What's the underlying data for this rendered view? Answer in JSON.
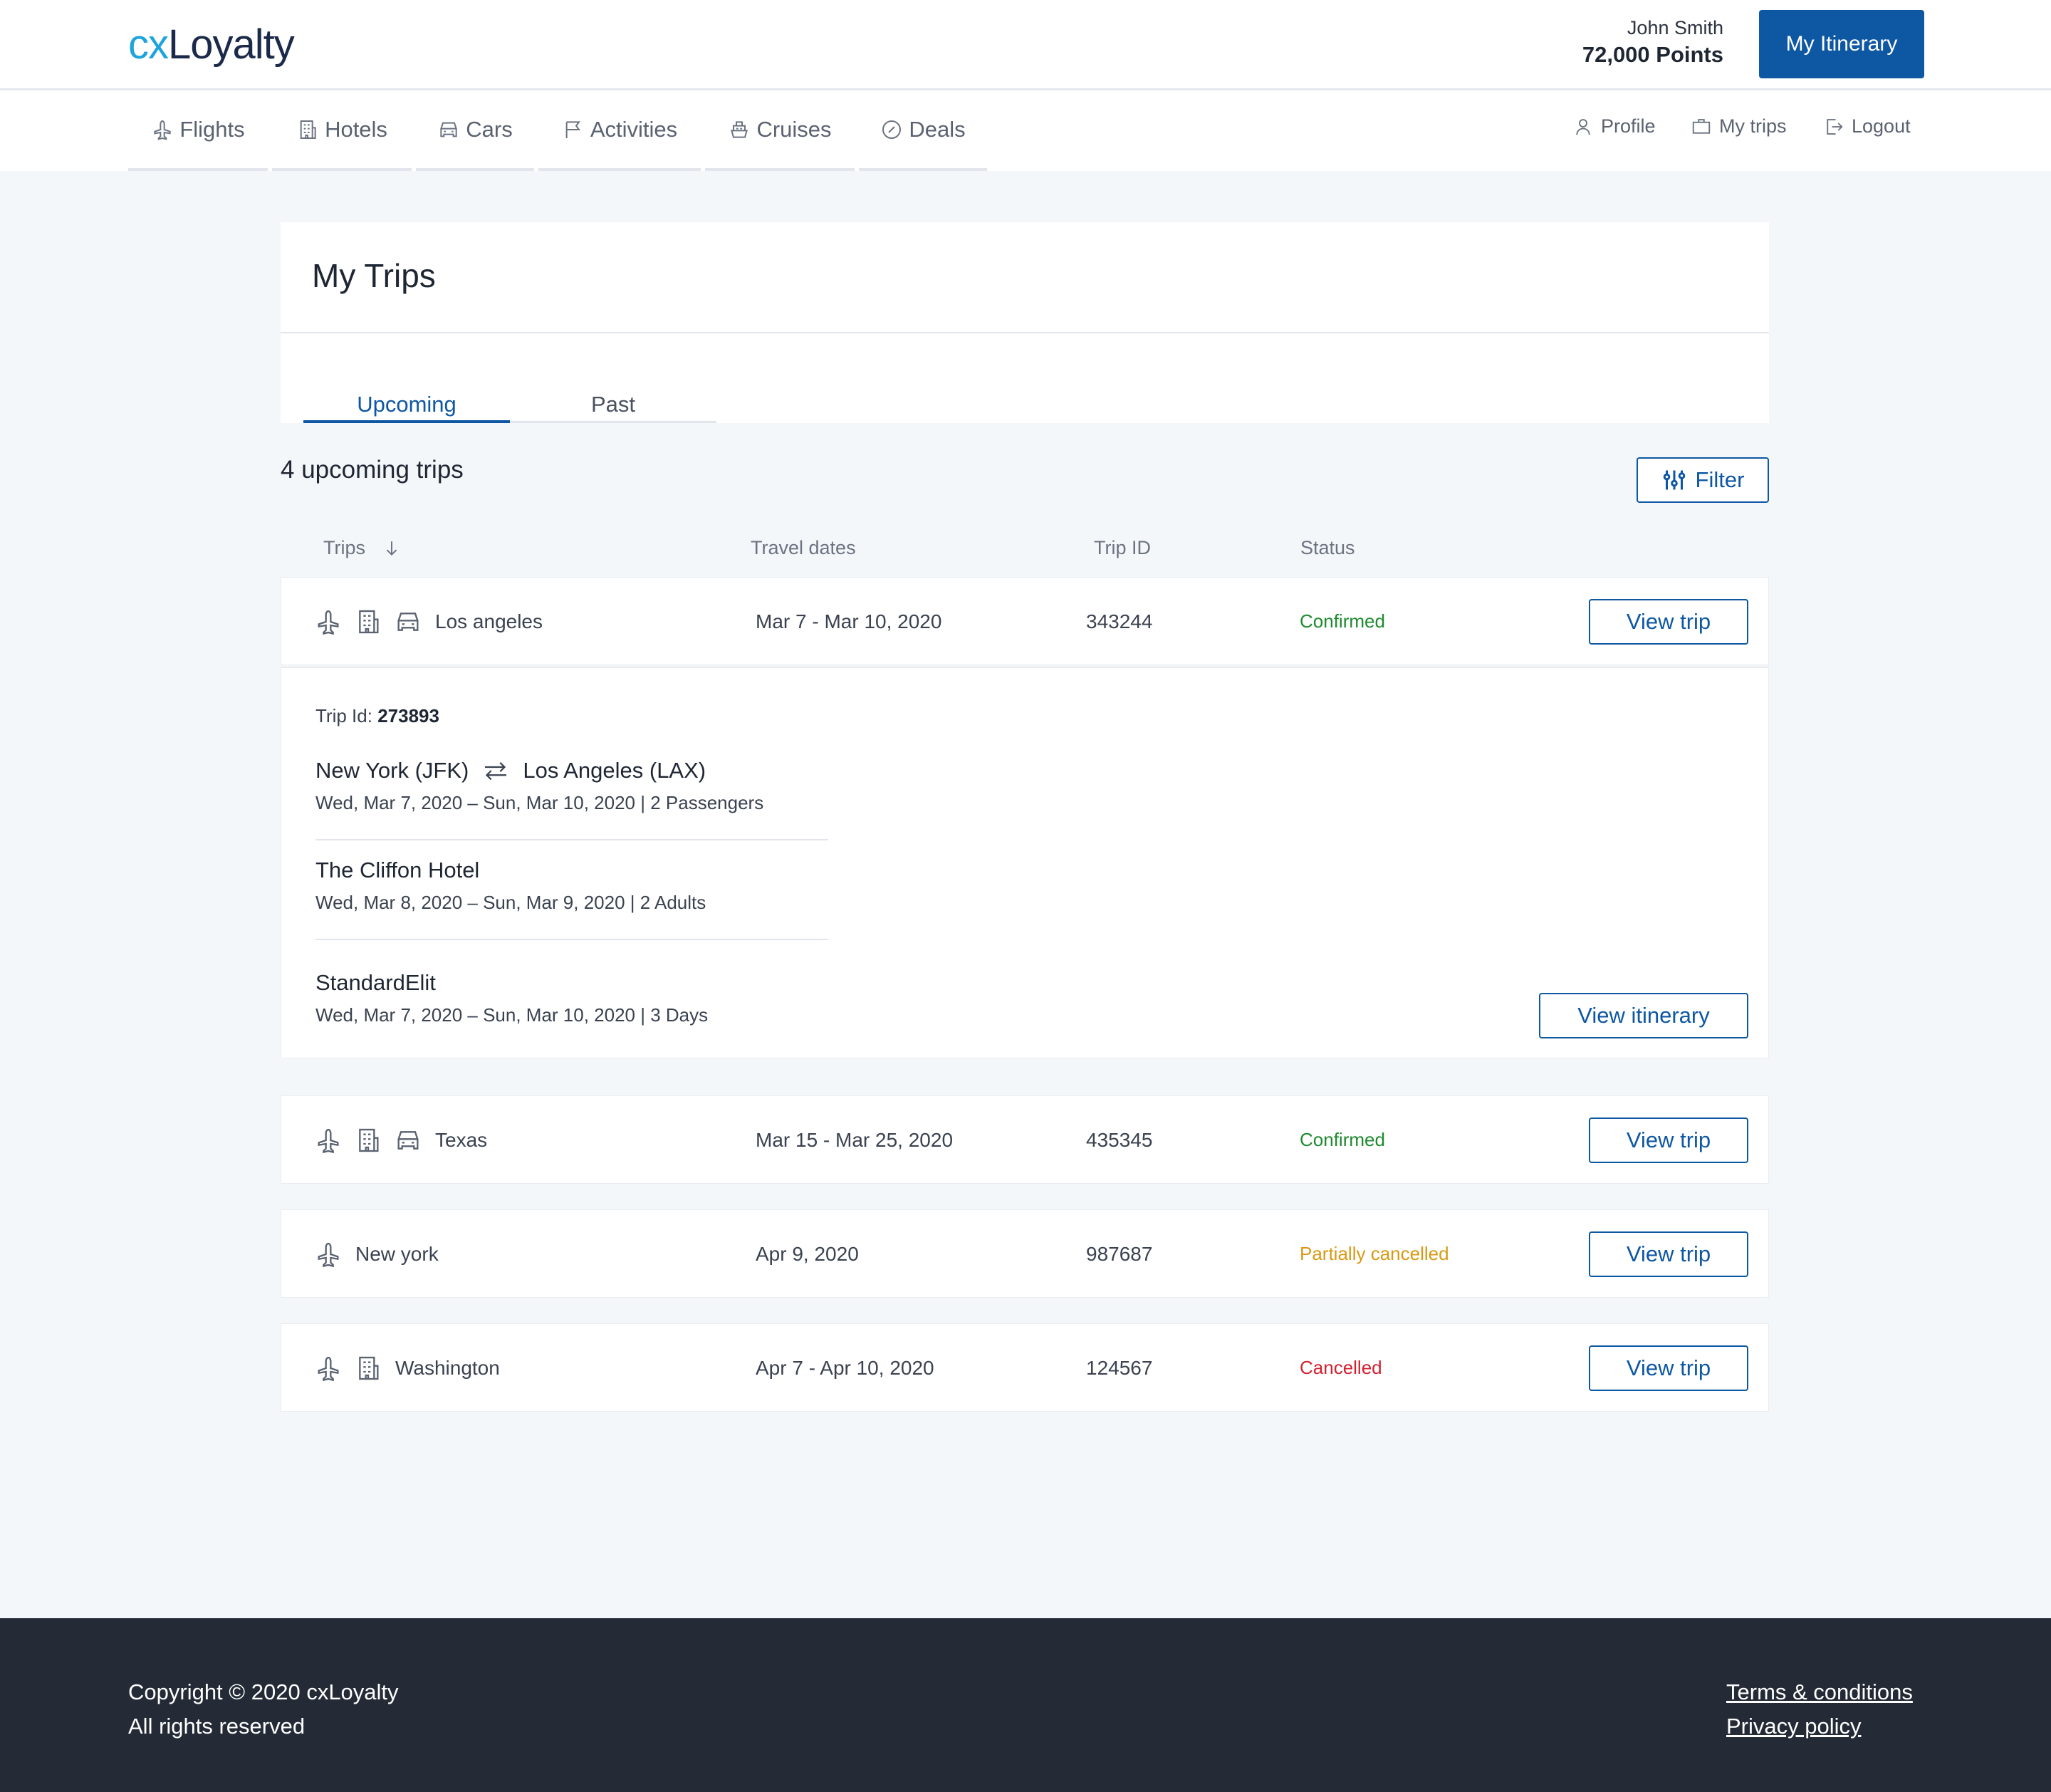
{
  "header": {
    "logo_cx": "cx",
    "logo_rest": "Loyalty",
    "user_name": "John Smith",
    "points": "72,000 Points",
    "itinerary_button": "My Itinerary"
  },
  "nav": {
    "items": [
      {
        "label": "Flights",
        "icon": "plane-icon"
      },
      {
        "label": "Hotels",
        "icon": "building-icon"
      },
      {
        "label": "Cars",
        "icon": "car-icon"
      },
      {
        "label": "Activities",
        "icon": "flag-icon"
      },
      {
        "label": "Cruises",
        "icon": "ship-icon"
      },
      {
        "label": "Deals",
        "icon": "badge-percent-icon"
      }
    ],
    "utility": [
      {
        "label": "Profile",
        "icon": "person-icon"
      },
      {
        "label": "My trips",
        "icon": "briefcase-icon"
      },
      {
        "label": "Logout",
        "icon": "logout-icon"
      }
    ]
  },
  "main": {
    "title": "My Trips",
    "tabs": [
      "Upcoming",
      "Past"
    ],
    "count": "4 upcoming trips",
    "filter_label": "Filter",
    "columns": [
      "Trips",
      "Travel dates",
      "Trip ID",
      "Status"
    ],
    "trips": [
      {
        "city": "Los angeles",
        "dates": "Mar 7 - Mar 10, 2020",
        "trip_id": "343244",
        "status": "Confirmed",
        "status_color": "#1e8a2e",
        "icons": [
          "plane-icon",
          "building-icon",
          "car-icon"
        ],
        "button": "View trip"
      },
      {
        "city": "Texas",
        "dates": "Mar 15 - Mar 25, 2020",
        "trip_id": "435345",
        "status": "Confirmed",
        "status_color": "#1e8a2e",
        "icons": [
          "plane-icon",
          "building-icon",
          "car-icon"
        ],
        "button": "View trip"
      },
      {
        "city": "New york",
        "dates": "Apr 9, 2020",
        "trip_id": "987687",
        "status": "Partially cancelled",
        "status_color": "#d89a14",
        "icons": [
          "plane-icon"
        ],
        "button": "View trip"
      },
      {
        "city": "Washington",
        "dates": "Apr 7 - Apr 10, 2020",
        "trip_id": "124567",
        "status": "Cancelled",
        "status_color": "#d0212f",
        "icons": [
          "plane-icon",
          "building-icon"
        ],
        "button": "View trip"
      }
    ],
    "details": {
      "trip_id_label": "Trip Id:",
      "trip_id_value": "273893",
      "route_from": "New York (JFK)",
      "route_to": "Los Angeles (LAX)",
      "flight_info": "Wed, Mar 7, 2020 – Sun, Mar 10, 2020 | 2 Passengers",
      "hotel_name": "The Cliffon Hotel",
      "hotel_info": "Wed, Mar 8, 2020 – Sun, Mar 9, 2020 | 2 Adults",
      "car_name": "StandardElit",
      "car_info": "Wed, Mar 7, 2020 – Sun, Mar 10, 2020 | 3 Days",
      "itinerary_button": "View itinerary"
    }
  },
  "footer": {
    "copyright": "Copyright © 2020 cxLoyalty",
    "rights": "All rights reserved",
    "terms": "Terms & conditions",
    "privacy": "Privacy policy"
  },
  "colors": {
    "primary": "#0d57a3",
    "logo_cx": "#1ea3dd",
    "footer_bg": "#242b36",
    "page_bg": "#f4f7fa"
  }
}
